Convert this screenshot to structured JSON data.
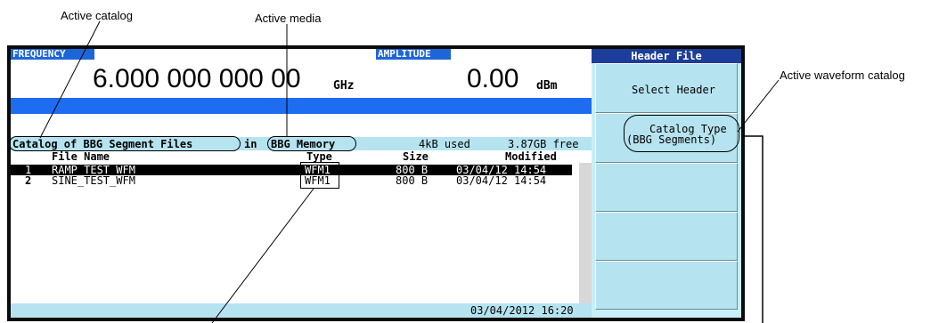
{
  "callouts": {
    "active_catalog": "Active catalog",
    "active_media": "Active media",
    "active_waveform_catalog": "Active waveform catalog"
  },
  "frequency": {
    "label": "FREQUENCY",
    "value": "6.000 000 000 00",
    "unit": "GHz"
  },
  "amplitude": {
    "label": "AMPLITUDE",
    "value": "0.00",
    "unit": "dBm"
  },
  "catalog": {
    "title": "Catalog of BBG Segment Files",
    "in_text": "in",
    "media": "BBG Memory",
    "used": "4kB used",
    "free": "3.87GB free"
  },
  "columns": {
    "file_name": "File Name",
    "type": "Type",
    "size": "Size",
    "modified": "Modified"
  },
  "files": [
    {
      "index": "1",
      "name": "RAMP_TEST_WFM",
      "type": "WFM1",
      "size": "800 B",
      "modified": "03/04/12 14:54",
      "selected": true
    },
    {
      "index": "2",
      "name": "SINE_TEST_WFM",
      "type": "WFM1",
      "size": "800 B",
      "modified": "03/04/12 14:54",
      "selected": false
    }
  ],
  "status": {
    "datetime": "03/04/2012 16:20"
  },
  "softkeys": {
    "title": "Header File",
    "select_header": "Select Header",
    "catalog_type_line1": "Catalog Type",
    "catalog_type_line2": "(BBG Segments)"
  },
  "colors": {
    "accent_blue": "#1e6cf0",
    "panel": "#b5e3f0",
    "frame": "#0b0b0b"
  }
}
